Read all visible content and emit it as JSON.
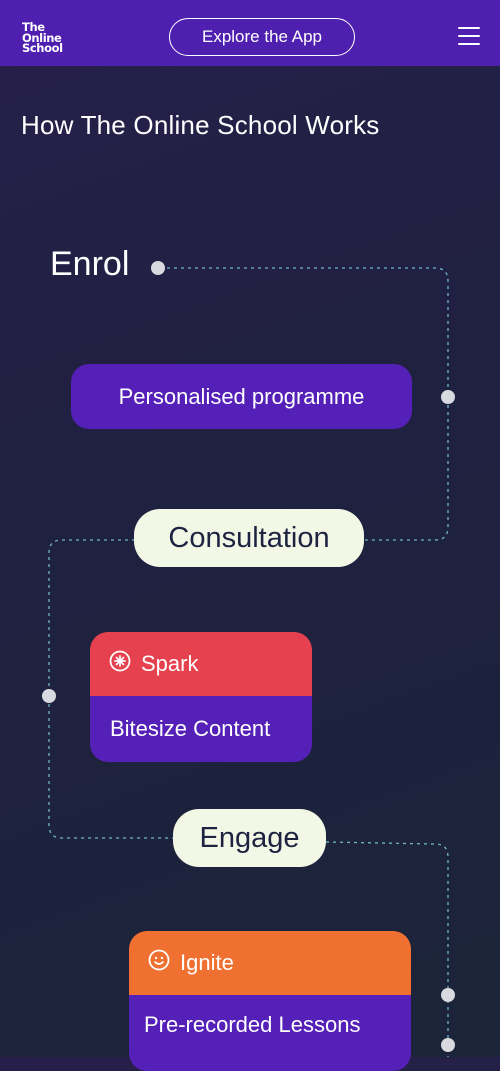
{
  "header": {
    "logo_lines": [
      "The",
      "Online",
      "School"
    ],
    "explore_button": "Explore the App",
    "menu_icon": "hamburger-icon"
  },
  "colors": {
    "header_bg": "#4f1fb0",
    "primary_pill": "#5520b8",
    "light_pill": "#f3f7e6",
    "spark": "#e5414f",
    "ignite": "#ef7030",
    "path_line": "#7fd0e0",
    "node_dot": "#d9dadf"
  },
  "main": {
    "title": "How The Online School Works",
    "steps": {
      "enrol": "Enrol",
      "personalised": "Personalised programme",
      "consultation": "Consultation",
      "spark_label": "Spark",
      "spark_icon": "spark-icon",
      "spark_content": "Bitesize Content",
      "engage": "Engage",
      "ignite_label": "Ignite",
      "ignite_icon": "smiley-icon",
      "ignite_content": "Pre-recorded Lessons"
    }
  }
}
